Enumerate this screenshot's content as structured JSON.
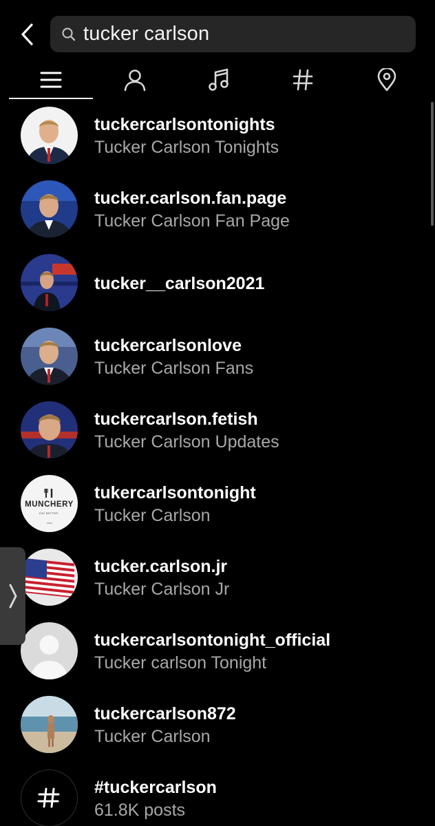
{
  "search": {
    "query": "tucker carlson"
  },
  "tabs": [
    {
      "name": "top",
      "icon": "menu-icon"
    },
    {
      "name": "accounts",
      "icon": "person-icon"
    },
    {
      "name": "audio",
      "icon": "music-note-icon"
    },
    {
      "name": "tags",
      "icon": "hashtag-icon"
    },
    {
      "name": "places",
      "icon": "location-pin-icon"
    }
  ],
  "results": [
    {
      "username": "tuckercarlsontonights",
      "fullname": "Tucker Carlson Tonights",
      "avatar": "portrait-suit"
    },
    {
      "username": "tucker.carlson.fan.page",
      "fullname": "Tucker Carlson Fan Page",
      "avatar": "portrait-blue"
    },
    {
      "username": "tucker__carlson2021",
      "fullname": "",
      "avatar": "portrait-studio"
    },
    {
      "username": "tuckercarlsonlove",
      "fullname": "Tucker Carlson Fans",
      "avatar": "portrait-suit"
    },
    {
      "username": "tuckercarlson.fetish",
      "fullname": "Tucker Carlson Updates",
      "avatar": "portrait-blue"
    },
    {
      "username": "tukercarlsontonight",
      "fullname": "Tucker Carlson",
      "avatar": "munchery-logo",
      "logo_text": "MUNCHERY",
      "logo_tagline": "EAT BETTER."
    },
    {
      "username": "tucker.carlson.jr",
      "fullname": "Tucker Carlson Jr",
      "avatar": "us-flag"
    },
    {
      "username": "tuckercarlsontonight_official",
      "fullname": "Tucker carlson Tonight",
      "avatar": "default-avatar"
    },
    {
      "username": "tuckercarlson872",
      "fullname": "Tucker Carlson",
      "avatar": "beach-photo"
    },
    {
      "username": "#tuckercarlson",
      "fullname": "61.8K posts",
      "avatar": "hashtag"
    }
  ],
  "colors": {
    "background": "#000000",
    "search_bg": "#262626",
    "secondary_text": "#a8a8a8"
  }
}
